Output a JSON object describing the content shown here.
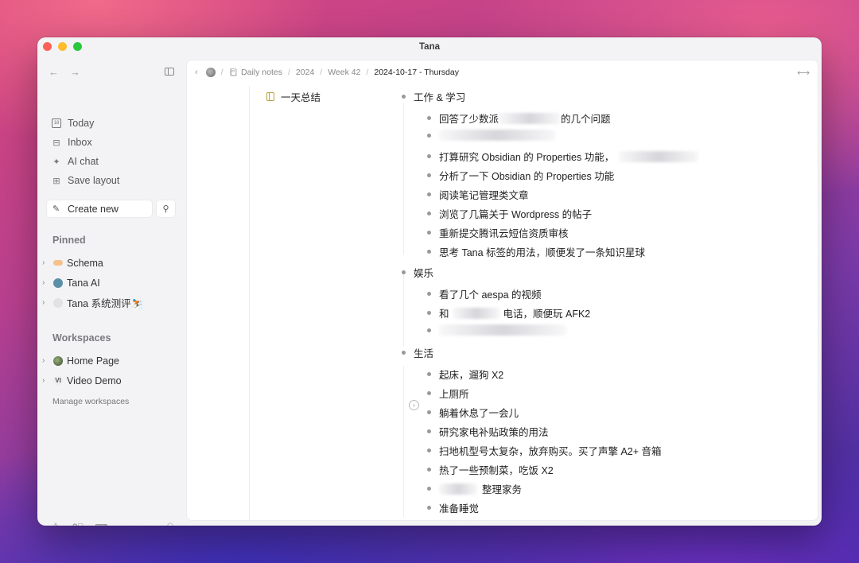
{
  "window": {
    "title": "Tana"
  },
  "sidebar": {
    "menu": [
      {
        "label": "Today",
        "icon": "calendar-icon"
      },
      {
        "label": "Inbox",
        "icon": "inbox-icon"
      },
      {
        "label": "AI chat",
        "icon": "sparkle-icon"
      },
      {
        "label": "Save layout",
        "icon": "layout-icon"
      }
    ],
    "create_new": "Create new",
    "pinned_title": "Pinned",
    "pinned": [
      {
        "label": "Schema",
        "emoji": "pill-icon"
      },
      {
        "label": "Tana AI",
        "emoji": "robot-icon"
      },
      {
        "label": "Tana 系统测评⛷️",
        "emoji": "bowl-icon"
      }
    ],
    "workspaces_title": "Workspaces",
    "workspaces": [
      {
        "label": "Home Page",
        "emoji": "globe-icon"
      },
      {
        "label": "Video Demo",
        "emoji": "vi-icon"
      }
    ],
    "manage_workspaces": "Manage workspaces"
  },
  "breadcrumb": {
    "items": [
      "Daily notes",
      "2024",
      "Week 42"
    ],
    "current": "2024-10-17 - Thursday"
  },
  "field": {
    "label": "一天总结"
  },
  "outline": {
    "sections": [
      {
        "title": "工作 & 学习",
        "items": [
          {
            "before": "回答了少数派",
            "after": "的几个问题"
          },
          {
            "before": "",
            "after": ""
          },
          {
            "before": "打算研究 Obsidian 的 Properties 功能，",
            "after": ""
          },
          {
            "before": "分析了一下 Obsidian 的 Properties 功能",
            "after": ""
          },
          {
            "before": "阅读笔记管理类文章",
            "after": ""
          },
          {
            "before": "浏览了几篇关于 Wordpress 的帖子",
            "after": ""
          },
          {
            "before": "重新提交腾讯云短信资质审核",
            "after": ""
          },
          {
            "before": "思考 Tana 标签的用法，顺便发了一条知识星球",
            "after": ""
          }
        ]
      },
      {
        "title": "娱乐",
        "items": [
          {
            "before": "看了几个 aespa 的视频",
            "after": ""
          },
          {
            "before": "和",
            "after": "电话，顺便玩 AFK2"
          },
          {
            "before": "",
            "after": ""
          }
        ]
      },
      {
        "title": "生活",
        "items": [
          {
            "before": "起床，遛狗 X2",
            "after": ""
          },
          {
            "before": "上厕所",
            "after": ""
          },
          {
            "before": "躺着休息了一会儿",
            "after": ""
          },
          {
            "before": "研究家电补贴政策的用法",
            "after": ""
          },
          {
            "before": "扫地机型号太复杂，放弃购买。买了声擎 A2+ 音箱",
            "after": ""
          },
          {
            "before": "热了一些预制菜，吃饭 X2",
            "after": ""
          },
          {
            "before": "",
            "after": "整理家务"
          },
          {
            "before": "准备睡觉",
            "after": ""
          }
        ]
      }
    ]
  }
}
